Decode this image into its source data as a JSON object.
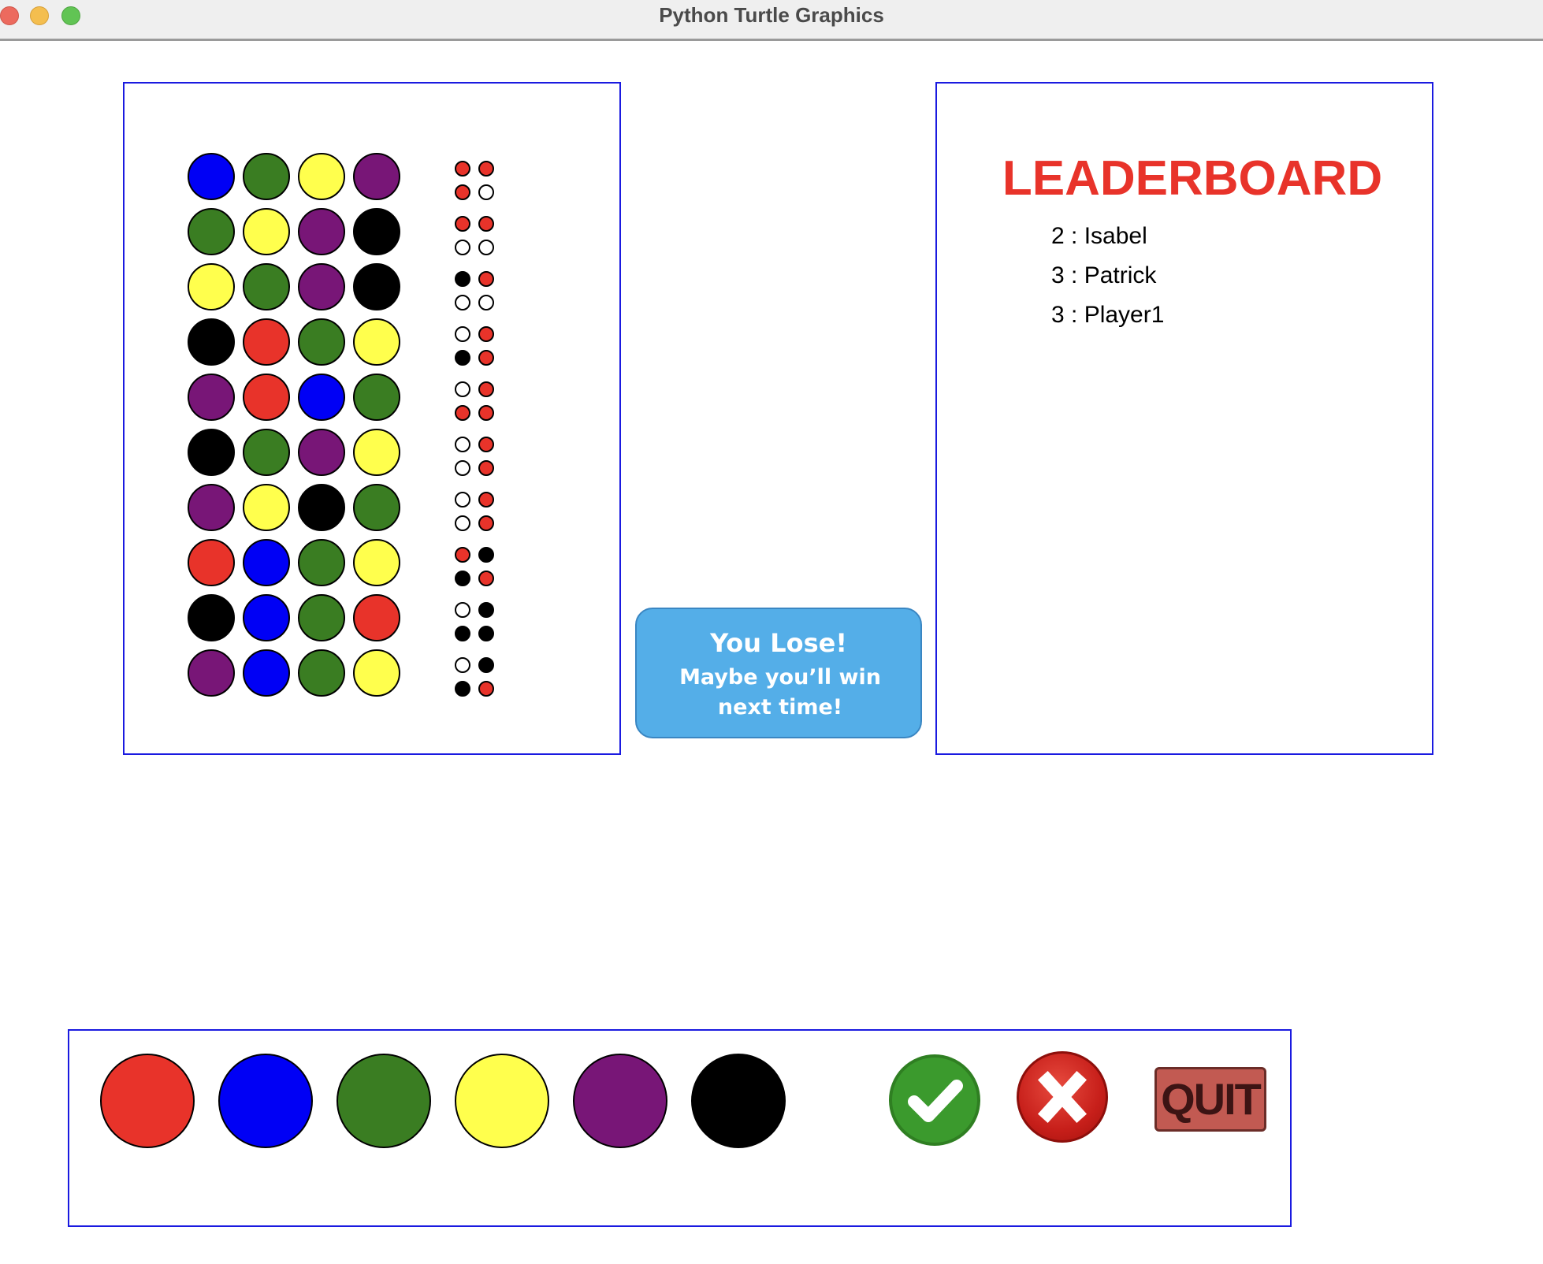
{
  "window": {
    "title": "Python Turtle Graphics"
  },
  "colors": {
    "red": "#e8332a",
    "blue": "#0000f5",
    "green": "#3a7d22",
    "yellow": "#ffff4d",
    "purple": "#781677",
    "black": "#000000",
    "white": "#ffffff"
  },
  "board": {
    "guesses": [
      [
        "blue",
        "green",
        "yellow",
        "purple"
      ],
      [
        "green",
        "yellow",
        "purple",
        "black"
      ],
      [
        "yellow",
        "green",
        "purple",
        "black"
      ],
      [
        "black",
        "red",
        "green",
        "yellow"
      ],
      [
        "purple",
        "red",
        "blue",
        "green"
      ],
      [
        "black",
        "green",
        "purple",
        "yellow"
      ],
      [
        "purple",
        "yellow",
        "black",
        "green"
      ],
      [
        "red",
        "blue",
        "green",
        "yellow"
      ],
      [
        "black",
        "blue",
        "green",
        "red"
      ],
      [
        "purple",
        "blue",
        "green",
        "yellow"
      ]
    ],
    "feedback": [
      [
        "red",
        "red",
        "red",
        "white"
      ],
      [
        "red",
        "red",
        "white",
        "white"
      ],
      [
        "black",
        "red",
        "white",
        "white"
      ],
      [
        "white",
        "red",
        "black",
        "red"
      ],
      [
        "white",
        "red",
        "red",
        "red"
      ],
      [
        "white",
        "red",
        "white",
        "red"
      ],
      [
        "white",
        "red",
        "white",
        "red"
      ],
      [
        "red",
        "black",
        "black",
        "red"
      ],
      [
        "white",
        "black",
        "black",
        "black"
      ],
      [
        "white",
        "black",
        "black",
        "red"
      ]
    ]
  },
  "result": {
    "title": "You Lose!",
    "message": "Maybe you’ll win next time!"
  },
  "leaderboard": {
    "title": "LEADERBOARD",
    "entries": [
      "2 : Isabel",
      "3 : Patrick",
      "3 : Player1"
    ]
  },
  "palette": {
    "pegs": [
      "red",
      "blue",
      "green",
      "yellow",
      "purple",
      "black"
    ],
    "check_icon": "checkmark-icon",
    "clear_icon": "x-icon",
    "quit_label": "QUIT"
  }
}
